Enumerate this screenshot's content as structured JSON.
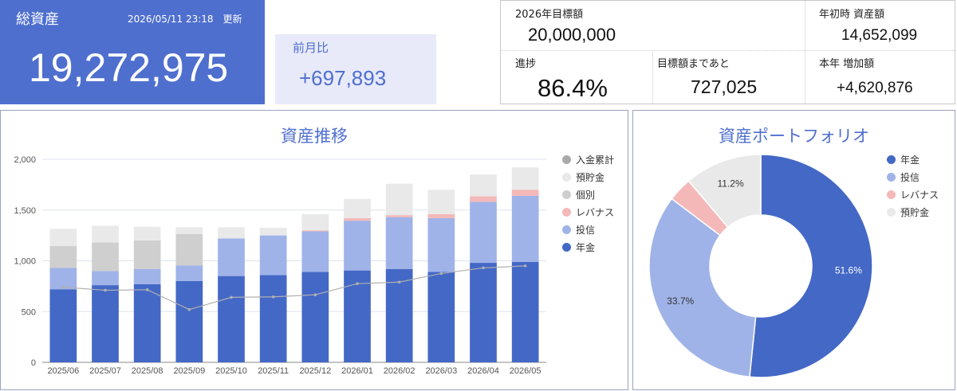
{
  "total": {
    "title": "総資産",
    "updated": "2026/05/11 23:18　更新",
    "value": "19,272,975"
  },
  "mom": {
    "label": "前月比",
    "value": "+697,893"
  },
  "stats": {
    "target_label": "2026年目標額",
    "target_value": "20,000,000",
    "start_label": "年初時 資産額",
    "start_value": "14,652,099",
    "progress_label": "進捗",
    "progress_value": "86.4%",
    "remaining_label": "目標額まであと",
    "remaining_value": "727,025",
    "increase_label": "本年 増加額",
    "increase_value": "+4,620,876"
  },
  "colors": {
    "accent": "#4f6fcf",
    "pension": "#4468c6",
    "invest": "#9fb3e8",
    "leverage": "#f4b8b8",
    "individual": "#cfcfcf",
    "deposit": "#e9e9e9",
    "cumulative": "#b0b0b0"
  },
  "chart_data": [
    {
      "type": "bar",
      "title": "資産推移",
      "categories": [
        "2025/06",
        "2025/07",
        "2025/08",
        "2025/09",
        "2025/10",
        "2025/11",
        "2025/12",
        "2026/01",
        "2026/02",
        "2026/03",
        "2026/04",
        "2026/05"
      ],
      "ylim": [
        0,
        2000
      ],
      "yticks": [
        "0",
        "500",
        "1,000",
        "1,500",
        "2,000"
      ],
      "stacked": true,
      "grid": true,
      "legend_position": "right",
      "series": [
        {
          "name": "年金",
          "color": "#4468c6",
          "values": [
            720,
            760,
            770,
            800,
            850,
            860,
            890,
            905,
            920,
            890,
            980,
            990
          ]
        },
        {
          "name": "投信",
          "color": "#9fb3e8",
          "values": [
            210,
            140,
            150,
            155,
            370,
            390,
            400,
            490,
            510,
            530,
            600,
            650
          ]
        },
        {
          "name": "レバナス",
          "color": "#f4b8b8",
          "values": [
            0,
            0,
            0,
            0,
            0,
            0,
            10,
            25,
            20,
            40,
            55,
            60
          ]
        },
        {
          "name": "個別",
          "color": "#cfcfcf",
          "values": [
            215,
            280,
            280,
            310,
            0,
            0,
            0,
            0,
            0,
            0,
            0,
            0
          ]
        },
        {
          "name": "預貯金",
          "color": "#e9e9e9",
          "values": [
            170,
            165,
            135,
            65,
            110,
            75,
            160,
            190,
            310,
            240,
            215,
            220
          ]
        }
      ],
      "line": {
        "name": "入金累計",
        "color": "#b0b0b0",
        "values": [
          740,
          710,
          715,
          520,
          640,
          645,
          665,
          775,
          790,
          875,
          930,
          950
        ]
      }
    },
    {
      "type": "pie",
      "title": "資産ポートフォリオ",
      "donut": true,
      "legend_position": "right",
      "slices": [
        {
          "name": "年金",
          "value": 51.6,
          "label": "51.6%",
          "color": "#4468c6"
        },
        {
          "name": "投信",
          "value": 33.7,
          "label": "33.7%",
          "color": "#9fb3e8"
        },
        {
          "name": "レバナス",
          "value": 3.5,
          "label": "",
          "color": "#f4b8b8"
        },
        {
          "name": "預貯金",
          "value": 11.2,
          "label": "11.2%",
          "color": "#e9e9e9"
        }
      ]
    }
  ]
}
